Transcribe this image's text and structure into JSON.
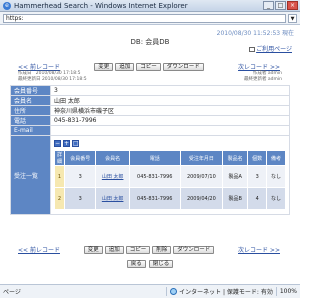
{
  "window": {
    "title": "Hammerhead Search - Windows Internet Explorer",
    "address": "https:"
  },
  "page": {
    "datetime": "2010/08/30 11:52:53 現在",
    "title": "DB: 会員DB",
    "usage_link": "ご利用ページ"
  },
  "nav": {
    "prev": "<< 前レコード",
    "next": "次レコード >>"
  },
  "toolbar_top": [
    "変更",
    "追加",
    "コピー",
    "ダウンロード"
  ],
  "toolbar_bottom": [
    "変更",
    "追加",
    "コピー",
    "削除",
    "ダウンロード"
  ],
  "meta": {
    "created_label": "作成日",
    "created_value": "2010/08/30 17:18:5",
    "updated_label": "最終更新日",
    "updated_value": "2010/08/30 17:18:5",
    "creator_label": "作成者",
    "creator_value": "admin",
    "updater_label": "最終更新者",
    "updater_value": "admin"
  },
  "fields": [
    {
      "label": "会員番号",
      "value": "3"
    },
    {
      "label": "会員名",
      "value": "山田 太郎"
    },
    {
      "label": "住所",
      "value": "神奈川県横浜市磯子区"
    },
    {
      "label": "電話",
      "value": "045-831-7996"
    },
    {
      "label": "E-mail",
      "value": ""
    }
  ],
  "orders": {
    "label": "受注一覧",
    "tools": [
      "−",
      "+",
      "□"
    ],
    "headers": [
      "詳細",
      "会員番号",
      "会員名",
      "電話",
      "受注年月日",
      "製品名",
      "個数",
      "備考"
    ],
    "rows": [
      {
        "no": "1",
        "member_no": "3",
        "member_name": "山田 太郎",
        "phone": "045-831-7996",
        "date": "2009/07/10",
        "product": "製品A",
        "qty": "3",
        "note": "なし"
      },
      {
        "no": "2",
        "member_no": "3",
        "member_name": "山田 太郎",
        "phone": "045-831-7996",
        "date": "2009/04/20",
        "product": "製品B",
        "qty": "4",
        "note": "なし"
      }
    ]
  },
  "footer_buttons": [
    "戻る",
    "閉じる"
  ],
  "status": {
    "left": "ページ",
    "zone": "インターネット | 保護モード: 有効",
    "zoom": "100%"
  }
}
